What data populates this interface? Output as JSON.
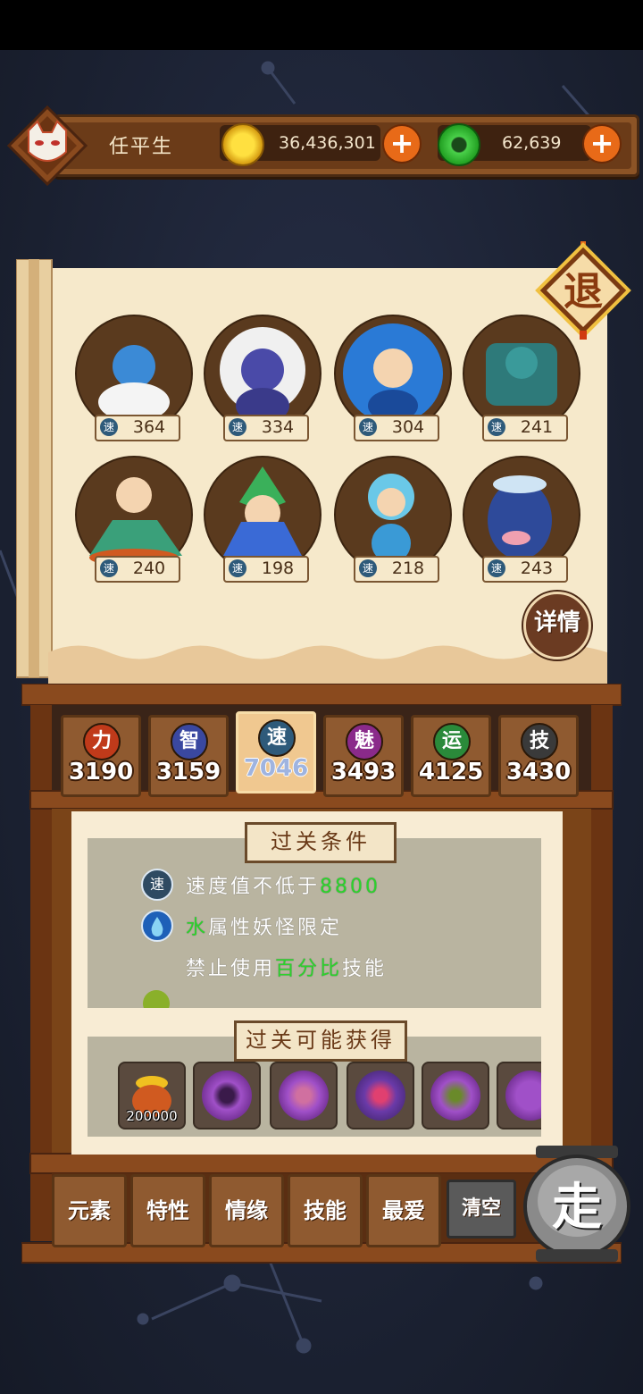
{
  "player": {
    "name": "任平生"
  },
  "currency": {
    "gold": "36,436,301",
    "jade": "62,639"
  },
  "buttons": {
    "exit": "退",
    "detail": "详情",
    "go": "走"
  },
  "heroes": [
    {
      "speed": "364",
      "color": "#3b8ad6"
    },
    {
      "speed": "334",
      "color": "#4a4aa8"
    },
    {
      "speed": "304",
      "color": "#2a7ad6"
    },
    {
      "speed": "241",
      "color": "#2e7a7a"
    },
    {
      "speed": "240",
      "color": "#3aa07a"
    },
    {
      "speed": "198",
      "color": "#3a6ad6"
    },
    {
      "speed": "218",
      "color": "#6ac8e8"
    },
    {
      "speed": "243",
      "color": "#2e4a9a"
    }
  ],
  "speed_icon": "速",
  "attributes": [
    {
      "icon": "力",
      "value": "3190",
      "color": "#c03a1a"
    },
    {
      "icon": "智",
      "value": "3159",
      "color": "#3a48a0"
    },
    {
      "icon": "速",
      "value": "7046",
      "color": "#2e5a7a",
      "active": true
    },
    {
      "icon": "魅",
      "value": "3493",
      "color": "#8a2a8a"
    },
    {
      "icon": "运",
      "value": "4125",
      "color": "#2a8a3a"
    },
    {
      "icon": "技",
      "value": "3430",
      "color": "#3a3a3a"
    }
  ],
  "conditions": {
    "title": "过关条件",
    "line1_pre": "速度值不低于",
    "line1_hl": "8800",
    "line2_hl": "水",
    "line2_post": "属性妖怪限定",
    "line3_pre": "禁止使用",
    "line3_hl": "百分比",
    "line3_post": "技能"
  },
  "rewards": {
    "title": "过关可能获得",
    "items": [
      {
        "qty": "200000",
        "icon": "gold-pot-icon"
      },
      {
        "qty": "",
        "icon": "purple-orb-icon"
      },
      {
        "qty": "",
        "icon": "purple-orb-icon"
      },
      {
        "qty": "",
        "icon": "purple-orb-icon"
      },
      {
        "qty": "",
        "icon": "purple-orb-icon"
      }
    ]
  },
  "tabs": [
    "元素",
    "特性",
    "情缘",
    "技能",
    "最爱",
    "清空"
  ]
}
